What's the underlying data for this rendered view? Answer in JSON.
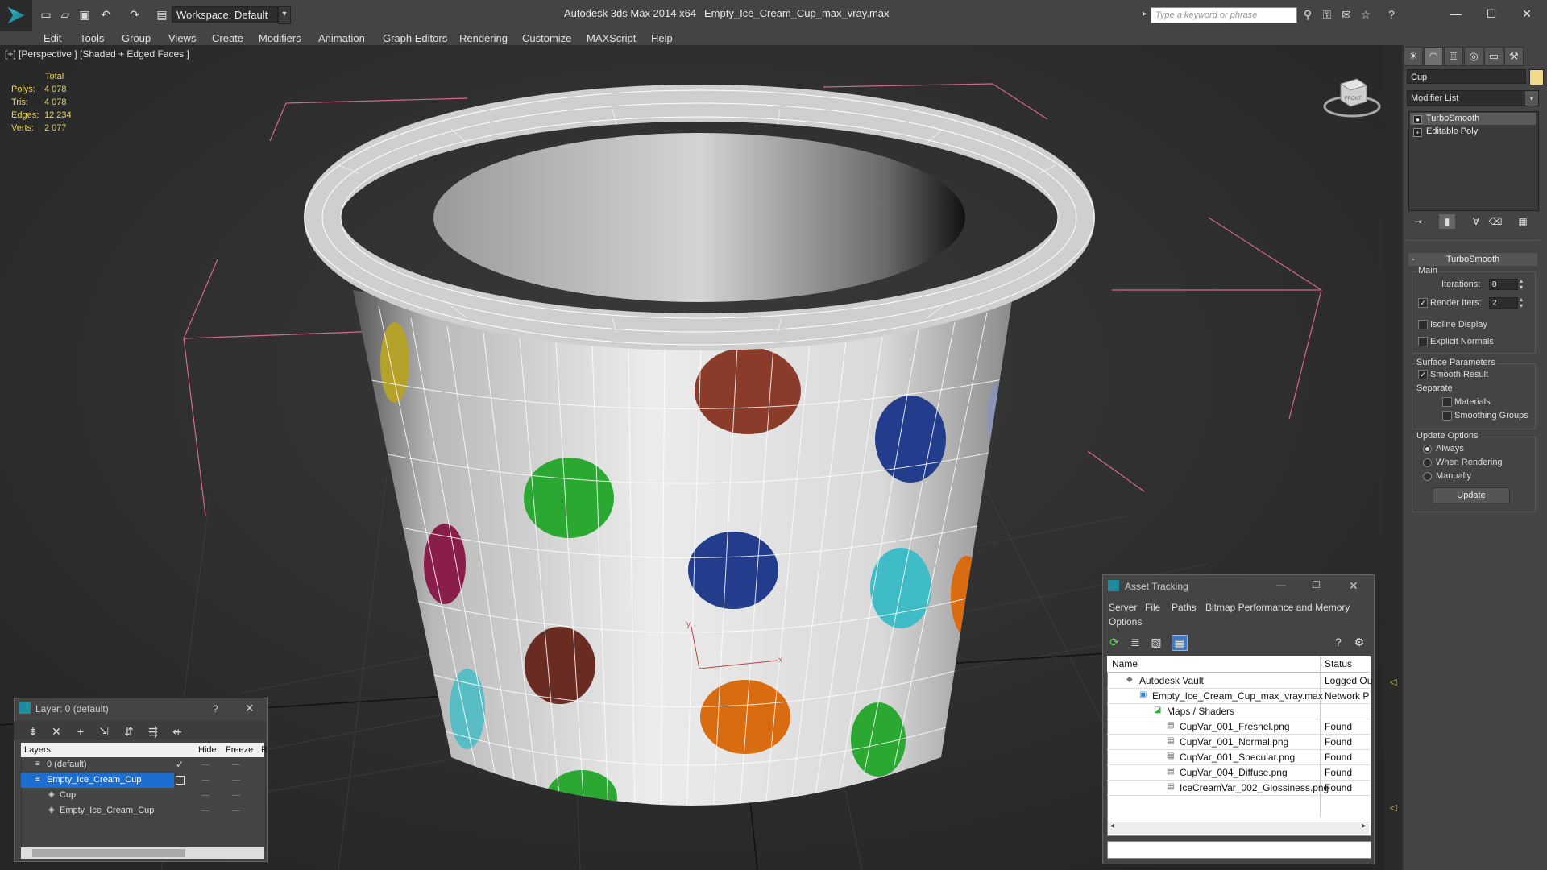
{
  "title_bar": {
    "app_title": "Autodesk 3ds Max  2014 x64",
    "file_title": "Empty_Ice_Cream_Cup_max_vray.max",
    "workspace": "Workspace: Default",
    "search_placeholder": "Type a keyword or phrase"
  },
  "menu": [
    "Edit",
    "Tools",
    "Group",
    "Views",
    "Create",
    "Modifiers",
    "Animation",
    "Graph Editors",
    "Rendering",
    "Customize",
    "MAXScript",
    "Help"
  ],
  "viewport": {
    "label": "[+] [Perspective ] [Shaded + Edged Faces ]",
    "stats": {
      "header": "Total",
      "rows": [
        {
          "label": "Polys:",
          "value": "4 078"
        },
        {
          "label": "Tris:",
          "value": "4 078"
        },
        {
          "label": "Edges:",
          "value": "12 234"
        },
        {
          "label": "Verts:",
          "value": "2 077"
        }
      ]
    },
    "viewcube_label": "FRONT"
  },
  "command_panel": {
    "object_name": "Cup",
    "modifier_list": "Modifier List",
    "stack": [
      {
        "label": "TurboSmooth",
        "selected": true
      },
      {
        "label": "Editable Poly",
        "selected": false
      }
    ],
    "rollout_title": "TurboSmooth",
    "main_group": "Main",
    "iterations_label": "Iterations:",
    "iterations_value": "0",
    "render_iters_label": "Render Iters:",
    "render_iters_value": "2",
    "isoline_label": "Isoline Display",
    "explicit_normals_label": "Explicit Normals",
    "surface_group": "Surface Parameters",
    "smooth_result_label": "Smooth Result",
    "separate_label": "Separate",
    "materials_label": "Materials",
    "smoothing_groups_label": "Smoothing Groups",
    "update_group": "Update Options",
    "always_label": "Always",
    "when_rendering_label": "When Rendering",
    "manually_label": "Manually",
    "update_button": "Update"
  },
  "layer_window": {
    "title": "Layer: 0 (default)",
    "help": "?",
    "columns": [
      "Layers",
      "Hide",
      "Freeze",
      "R"
    ],
    "rows": [
      {
        "name": "0 (default)",
        "indent": 0,
        "selected": false
      },
      {
        "name": "Empty_Ice_Cream_Cup",
        "indent": 0,
        "selected": true
      },
      {
        "name": "Cup",
        "indent": 1,
        "selected": false
      },
      {
        "name": "Empty_Ice_Cream_Cup",
        "indent": 1,
        "selected": false
      }
    ]
  },
  "asset_tracking": {
    "title": "Asset Tracking",
    "menu": [
      "Server",
      "File",
      "Paths",
      "Bitmap Performance and Memory",
      "Options"
    ],
    "columns": [
      "Name",
      "Status"
    ],
    "rows": [
      {
        "name": "Autodesk Vault",
        "status": "Logged Ou",
        "indent": 1
      },
      {
        "name": "Empty_Ice_Cream_Cup_max_vray.max",
        "status": "Network P",
        "indent": 2
      },
      {
        "name": "Maps / Shaders",
        "status": "",
        "indent": 3
      },
      {
        "name": "CupVar_001_Fresnel.png",
        "status": "Found",
        "indent": 4
      },
      {
        "name": "CupVar_001_Normal.png",
        "status": "Found",
        "indent": 4
      },
      {
        "name": "CupVar_001_Specular.png",
        "status": "Found",
        "indent": 4
      },
      {
        "name": "CupVar_004_Diffuse.png",
        "status": "Found",
        "indent": 4
      },
      {
        "name": "IceCreamVar_002_Glossiness.png",
        "status": "Found",
        "indent": 4
      }
    ]
  },
  "colors": {
    "accent": "#3399ff",
    "selection": "#1c6fd1",
    "object_color": "#f2d98a"
  }
}
